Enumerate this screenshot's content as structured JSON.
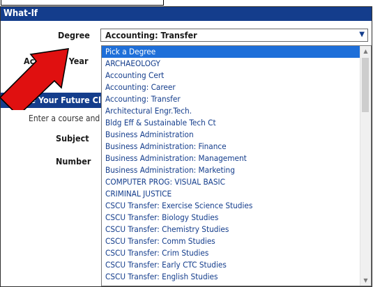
{
  "header": {
    "title": "What-If"
  },
  "form": {
    "degree_label": "Degree",
    "degree_value": "Accounting: Transfer",
    "academic_year_label": "Academic Year"
  },
  "future": {
    "header": "Choose Your Future Classes",
    "hint": "Enter a course and click Add Course",
    "subject_label": "Subject",
    "number_label": "Number"
  },
  "dropdown": {
    "options": [
      "Pick a Degree",
      "ARCHAEOLOGY",
      "Accounting Cert",
      "Accounting: Career",
      "Accounting: Transfer",
      "Architectural Engr.Tech.",
      "Bldg Eff & Sustainable Tech Ct",
      "Business Administration",
      "Business Administration: Finance",
      "Business Administration: Management",
      "Business Administration: Marketing",
      "COMPUTER PROG: VISUAL BASIC",
      "CRIMINAL JUSTICE",
      "CSCU Transfer: Exercise Science Studies",
      "CSCU Transfer: Biology Studies",
      "CSCU Transfer: Chemistry Studies",
      "CSCU Transfer: Comm Studies",
      "CSCU Transfer: Crim Studies",
      "CSCU Transfer: Early CTC Studies",
      "CSCU Transfer: English Studies"
    ],
    "highlighted_index": 0
  },
  "colors": {
    "header_bg": "#143d8c",
    "option_text": "#143d8c",
    "highlight_bg": "#1e6fd9",
    "arrow": "#e01010"
  }
}
